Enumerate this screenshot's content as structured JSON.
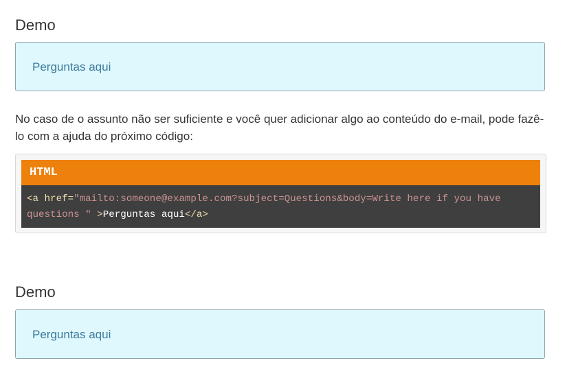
{
  "section1": {
    "heading": "Demo",
    "link_text": "Perguntas aqui"
  },
  "paragraph": "No caso de o assunto não ser suficiente e você quer adicionar algo ao conteúdo do e-mail, pode fazê-lo com a ajuda do próximo código:",
  "code_block": {
    "language": "HTML",
    "tokens": {
      "tag_open": "<a",
      "attr_name": " href=",
      "attr_value": "\"mailto:someone@example.com?subject=Questions&body=Write here if you have questions \"",
      "tag_close_bracket": " >",
      "inner_text": "Perguntas aqui",
      "end_tag": "</a>"
    }
  },
  "section2": {
    "heading": "Demo",
    "link_text": "Perguntas aqui"
  },
  "colors": {
    "demo_box_bg": "#dff8fd",
    "link": "#3a7a9c",
    "code_header": "#ee800c",
    "code_body": "#3f3f3f"
  }
}
